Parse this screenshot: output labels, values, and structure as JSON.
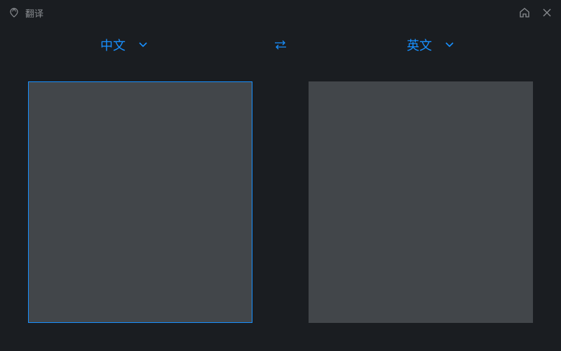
{
  "titlebar": {
    "app_title": "翻译"
  },
  "language_bar": {
    "source_lang": "中文",
    "target_lang": "英文"
  },
  "colors": {
    "accent": "#1890ff",
    "panel_bg": "#42464a",
    "app_bg": "#1a1d21",
    "text_muted": "#8a8d91"
  }
}
